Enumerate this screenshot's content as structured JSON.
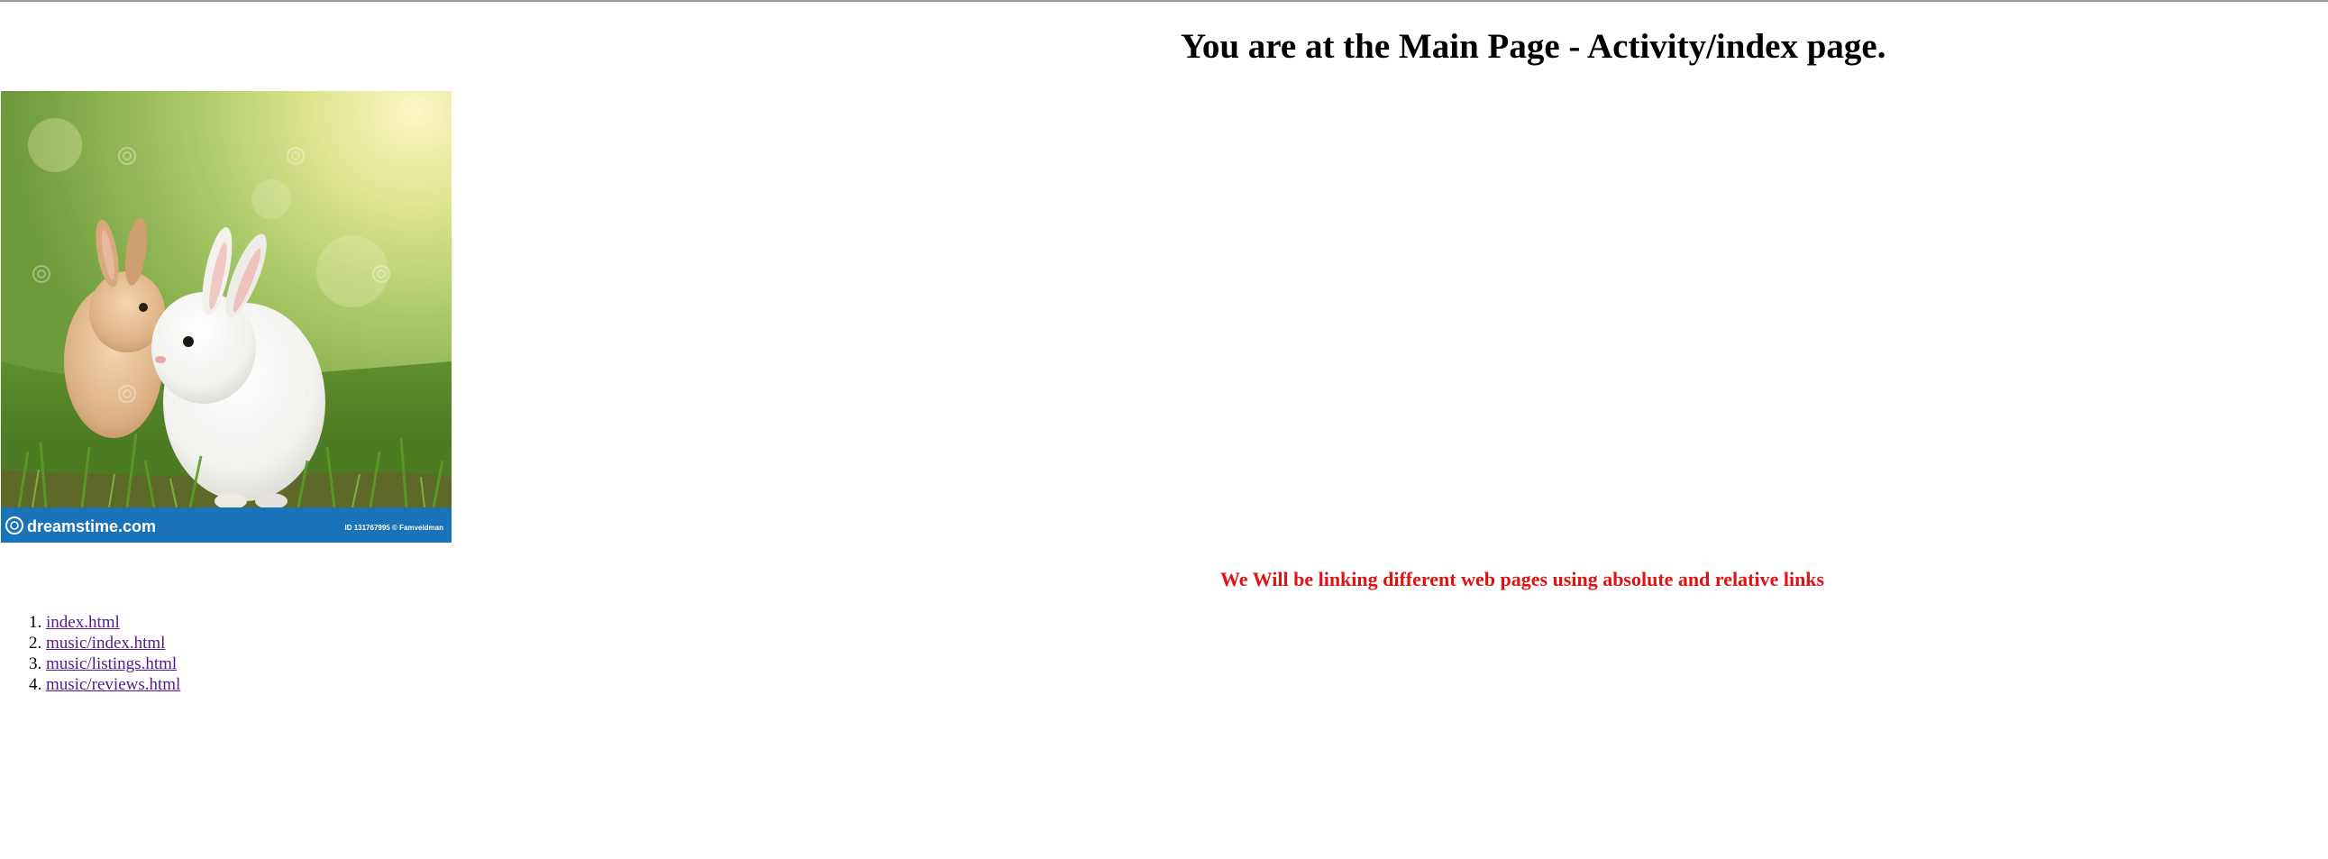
{
  "page": {
    "title": "You are at the Main Page - Activity/index page.",
    "subtitle": "We Will be linking different web pages using absolute and relative links",
    "subtitle_color": "#e01313"
  },
  "image": {
    "subject": "two rabbits in grass",
    "watermark_brand": "dreamstime.com",
    "watermark_id": "ID 131767995 © Famveldman",
    "banner_color": "#1a72b8"
  },
  "links": [
    {
      "label": "index.html"
    },
    {
      "label": "music/index.html"
    },
    {
      "label": "music/listings.html"
    },
    {
      "label": "music/reviews.html"
    }
  ],
  "link_color": "#551a8b"
}
